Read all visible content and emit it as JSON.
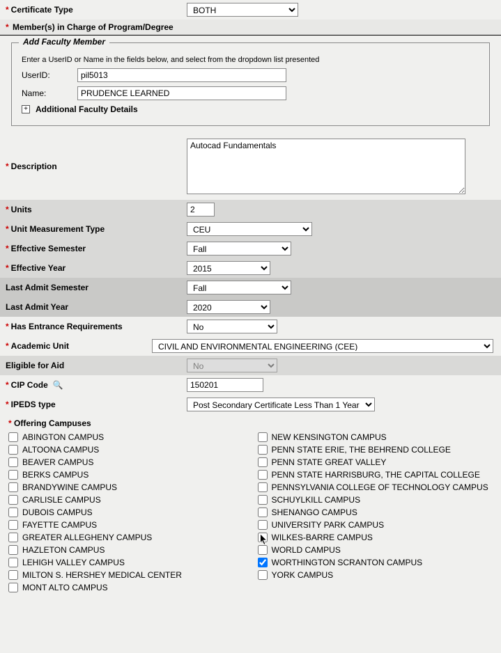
{
  "certificate_type": {
    "label": "Certificate Type",
    "value": "BOTH"
  },
  "members_header": "Member(s) in Charge of Program/Degree",
  "faculty": {
    "legend": "Add Faculty Member",
    "instructions": "Enter a UserID or Name in the fields below, and select from the dropdown list presented",
    "userid_label": "UserID:",
    "userid_value": "pil5013",
    "name_label": "Name:",
    "name_value": "PRUDENCE LEARNED",
    "additional": "Additional Faculty Details"
  },
  "description": {
    "label": "Description",
    "value": "Autocad Fundamentals"
  },
  "units": {
    "label": "Units",
    "value": "2"
  },
  "unit_measurement": {
    "label": "Unit Measurement Type",
    "value": "CEU"
  },
  "effective_semester": {
    "label": "Effective Semester",
    "value": "Fall"
  },
  "effective_year": {
    "label": "Effective Year",
    "value": "2015"
  },
  "last_admit_semester": {
    "label": "Last Admit Semester",
    "value": "Fall"
  },
  "last_admit_year": {
    "label": "Last Admit Year",
    "value": "2020"
  },
  "entrance_req": {
    "label": "Has Entrance Requirements",
    "value": "No"
  },
  "academic_unit": {
    "label": "Academic Unit",
    "value": "CIVIL AND ENVIRONMENTAL ENGINEERING (CEE)"
  },
  "eligible_aid": {
    "label": "Eligible for Aid",
    "value": "No"
  },
  "cip_code": {
    "label": "CIP Code",
    "value": "150201"
  },
  "ipeds": {
    "label": "IPEDS type",
    "value": "Post Secondary Certificate Less Than 1 Year"
  },
  "campuses": {
    "header": "Offering Campuses",
    "left": [
      {
        "name": "ABINGTON CAMPUS",
        "checked": false
      },
      {
        "name": "ALTOONA CAMPUS",
        "checked": false
      },
      {
        "name": "BEAVER CAMPUS",
        "checked": false
      },
      {
        "name": "BERKS CAMPUS",
        "checked": false
      },
      {
        "name": "BRANDYWINE CAMPUS",
        "checked": false
      },
      {
        "name": "CARLISLE CAMPUS",
        "checked": false
      },
      {
        "name": "DUBOIS CAMPUS",
        "checked": false
      },
      {
        "name": "FAYETTE CAMPUS",
        "checked": false
      },
      {
        "name": "GREATER ALLEGHENY CAMPUS",
        "checked": false
      },
      {
        "name": "HAZLETON CAMPUS",
        "checked": false
      },
      {
        "name": "LEHIGH VALLEY CAMPUS",
        "checked": false
      },
      {
        "name": "MILTON S. HERSHEY MEDICAL CENTER",
        "checked": false
      },
      {
        "name": "MONT ALTO CAMPUS",
        "checked": false
      }
    ],
    "right": [
      {
        "name": "NEW KENSINGTON CAMPUS",
        "checked": false
      },
      {
        "name": "PENN STATE ERIE, THE BEHREND COLLEGE",
        "checked": false
      },
      {
        "name": "PENN STATE GREAT VALLEY",
        "checked": false
      },
      {
        "name": "PENN STATE HARRISBURG, THE CAPITAL COLLEGE",
        "checked": false
      },
      {
        "name": "PENNSYLVANIA COLLEGE OF TECHNOLOGY CAMPUS",
        "checked": false
      },
      {
        "name": "SCHUYLKILL CAMPUS",
        "checked": false
      },
      {
        "name": "SHENANGO CAMPUS",
        "checked": false
      },
      {
        "name": "UNIVERSITY PARK CAMPUS",
        "checked": false
      },
      {
        "name": "WILKES-BARRE CAMPUS",
        "checked": false,
        "cursor": true
      },
      {
        "name": "WORLD CAMPUS",
        "checked": false
      },
      {
        "name": "WORTHINGTON SCRANTON CAMPUS",
        "checked": true
      },
      {
        "name": "YORK CAMPUS",
        "checked": false
      }
    ]
  }
}
